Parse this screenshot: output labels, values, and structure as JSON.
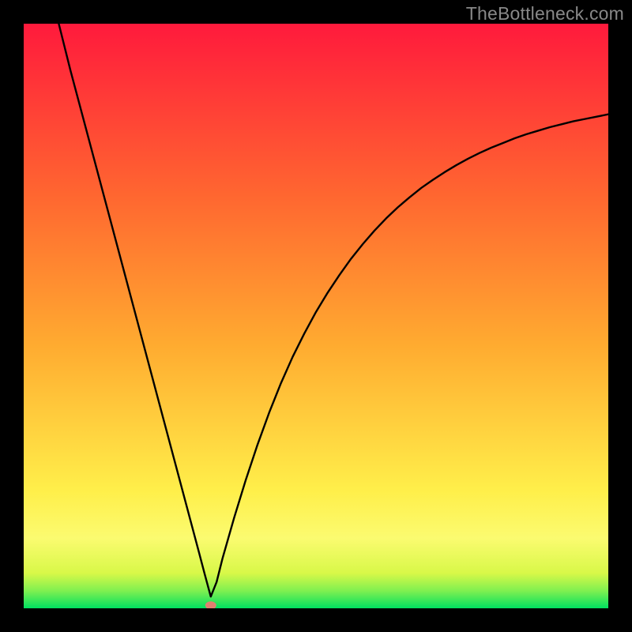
{
  "watermark": "TheBottleneck.com",
  "chart_data": {
    "type": "line",
    "title": "",
    "xlabel": "",
    "ylabel": "",
    "xlim": [
      0,
      100
    ],
    "ylim": [
      0,
      100
    ],
    "background": "rainbow-vertical",
    "gradient_stops": [
      {
        "pos": 0.0,
        "color": "#00e060"
      },
      {
        "pos": 0.03,
        "color": "#80f050"
      },
      {
        "pos": 0.06,
        "color": "#d8f848"
      },
      {
        "pos": 0.12,
        "color": "#fbfb70"
      },
      {
        "pos": 0.2,
        "color": "#ffef4a"
      },
      {
        "pos": 0.45,
        "color": "#ffab30"
      },
      {
        "pos": 0.7,
        "color": "#ff6830"
      },
      {
        "pos": 1.0,
        "color": "#ff1a3c"
      }
    ],
    "curve_description": "V-shaped bottleneck curve; steep near-linear left branch, gentler concave right branch; minimum near x≈32 at y≈0",
    "minimum_marker": {
      "x": 32,
      "y": 0.5,
      "color": "#e08070"
    },
    "series": [
      {
        "name": "bottleneck-curve",
        "x": [
          6,
          8,
          10,
          12,
          14,
          16,
          18,
          20,
          22,
          24,
          26,
          28,
          30,
          31,
          32,
          33,
          34,
          36,
          38,
          40,
          42,
          44,
          46,
          48,
          50,
          52,
          54,
          56,
          58,
          60,
          62,
          64,
          66,
          68,
          70,
          72,
          74,
          76,
          78,
          80,
          82,
          84,
          86,
          88,
          90,
          92,
          94,
          96,
          98,
          100
        ],
        "y": [
          100,
          92,
          84.5,
          77,
          69.5,
          62,
          54.5,
          47,
          39.5,
          32,
          24.5,
          17,
          9.5,
          5.7,
          2,
          4.5,
          8.5,
          15.5,
          22,
          28,
          33.5,
          38.5,
          43,
          47,
          50.7,
          54,
          57,
          59.8,
          62.3,
          64.6,
          66.7,
          68.6,
          70.3,
          71.9,
          73.3,
          74.6,
          75.8,
          76.9,
          77.9,
          78.8,
          79.6,
          80.4,
          81.1,
          81.7,
          82.3,
          82.8,
          83.3,
          83.7,
          84.1,
          84.5
        ]
      }
    ]
  }
}
